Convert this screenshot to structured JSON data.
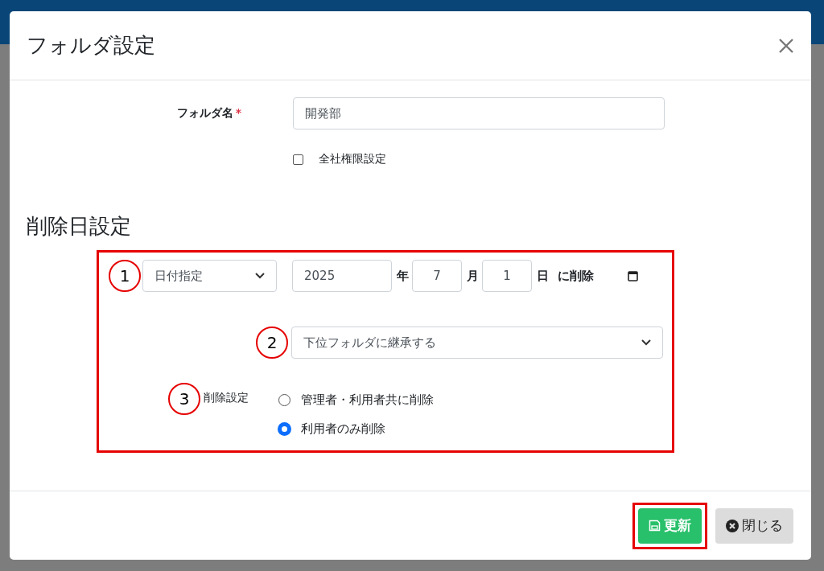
{
  "window": {
    "title": "フォルダ設定"
  },
  "folder_name": {
    "label": "フォルダ名",
    "required_mark": "*",
    "value": "開発部"
  },
  "company_permission": {
    "label": "全社権限設定",
    "checked": false
  },
  "deletion": {
    "heading": "削除日設定",
    "mode_select": "日付指定",
    "year": "2025",
    "year_unit": "年",
    "month": "7",
    "month_unit": "月",
    "day": "1",
    "day_unit": "日",
    "suffix": "に削除",
    "inherit_select": "下位フォルダに継承する",
    "setting_label": "削除設定",
    "options": [
      {
        "label": "管理者・利用者共に削除",
        "selected": false
      },
      {
        "label": "利用者のみ削除",
        "selected": true
      }
    ]
  },
  "annotations": [
    "1",
    "2",
    "3"
  ],
  "buttons": [
    {
      "kind": "primary",
      "label": "更新",
      "highlighted": true
    },
    {
      "kind": "secondary",
      "label": "閉じる",
      "highlighted": false
    }
  ]
}
